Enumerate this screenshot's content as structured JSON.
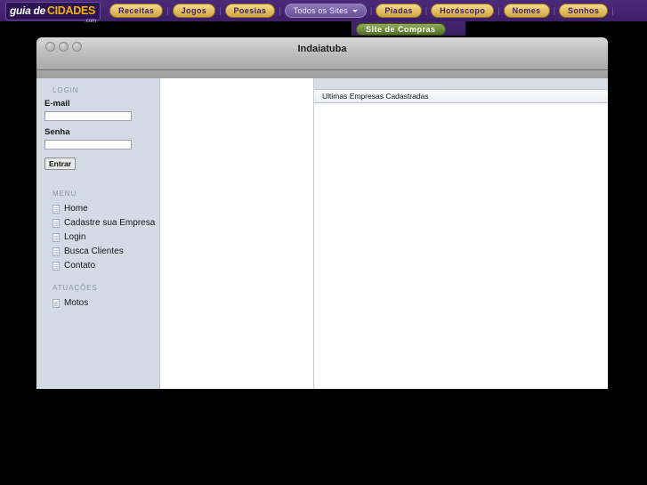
{
  "topnav": {
    "logo": {
      "part1": "guia de",
      "part2": "CIDADES",
      "part3": ".com"
    },
    "items": [
      {
        "label": "Receitas",
        "kind": "gold"
      },
      {
        "label": "Jogos",
        "kind": "gold"
      },
      {
        "label": "Poesias",
        "kind": "gold"
      },
      {
        "label": "Todos os Sites",
        "kind": "sites"
      },
      {
        "label": "Piadas",
        "kind": "gold"
      },
      {
        "label": "Horóscopo",
        "kind": "gold"
      },
      {
        "label": "Nomes",
        "kind": "gold"
      },
      {
        "label": "Sonhos",
        "kind": "gold"
      }
    ],
    "separator": "|",
    "shop_button": "Site de Compras"
  },
  "window": {
    "title": "Indaiatuba",
    "traffic_lights": [
      "close-button",
      "minimize-button",
      "zoom-button"
    ]
  },
  "sidebar": {
    "login": {
      "heading": "LOGIN",
      "email_label": "E-mail",
      "email_value": "",
      "email_placeholder": "",
      "password_label": "Senha",
      "password_value": "",
      "password_placeholder": "",
      "submit_label": "Entrar"
    },
    "menu": {
      "heading": "MENU",
      "items": [
        {
          "label": "Home"
        },
        {
          "label": "Cadastre sua Empresa"
        },
        {
          "label": "Login"
        },
        {
          "label": "Busca Clientes"
        },
        {
          "label": "Contato"
        }
      ]
    },
    "atuacoes": {
      "heading": "ATUAÇÕES",
      "items": [
        {
          "label": "Motos"
        }
      ]
    }
  },
  "right_panel": {
    "header": "Ultimas Empresas Cadastradas",
    "entries": []
  },
  "colors": {
    "nav_purple": "#45256f",
    "pill_gold": "#e5c068",
    "shop_green": "#6d8b3c",
    "sidebar_bg": "#d5dbe4",
    "desktop": "#000000"
  }
}
